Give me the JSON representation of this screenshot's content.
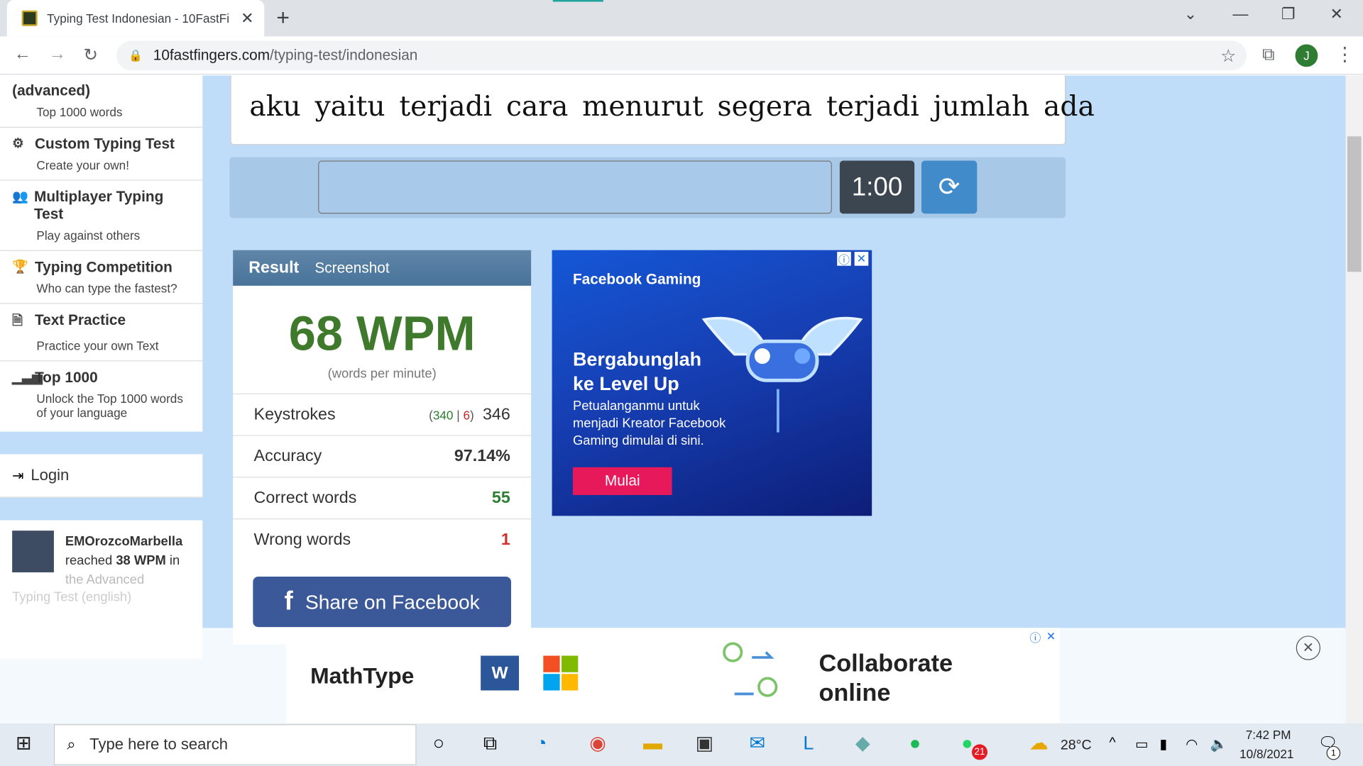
{
  "browser": {
    "tab_title": "Typing Test Indonesian - 10FastFi",
    "new_tab": "+",
    "url_host": "10fastfingers.com",
    "url_path": "/typing-test/indonesian",
    "avatar_letter": "J"
  },
  "sidebar": {
    "partial_item": {
      "title": "(advanced)",
      "sub": "Top 1000 words"
    },
    "items": [
      {
        "title": "Custom Typing Test",
        "sub": "Create your own!",
        "icon": "gears-icon"
      },
      {
        "title": "Multiplayer Typing Test",
        "sub": "Play against others",
        "icon": "users-icon"
      },
      {
        "title": "Typing Competition",
        "sub": "Who can type the fastest?",
        "icon": "trophy-icon"
      },
      {
        "title": "Text Practice",
        "sub": "Practice your own Text",
        "icon": "document-icon"
      },
      {
        "title": "Top 1000",
        "sub": "Unlock the Top 1000 words of your language",
        "icon": "signal-icon"
      }
    ],
    "login": "Login",
    "feed": {
      "user": "EMOrozcoMarbella",
      "text_a": "reached",
      "wpm": "38 WPM",
      "text_b": "in",
      "text_c": "the Advanced",
      "text_d": "Typing Test (english)"
    }
  },
  "test": {
    "words_line": "aku yaitu terjadi cara menurut segera terjadi jumlah ada",
    "timer": "1:00"
  },
  "result": {
    "tab_result": "Result",
    "tab_screenshot": "Screenshot",
    "wpm": "68 WPM",
    "wpm_sub": "(words per minute)",
    "rows": {
      "keystrokes_label": "Keystrokes",
      "keystrokes_ok": "340",
      "keystrokes_bad": "6",
      "keystrokes_total": "346",
      "accuracy_label": "Accuracy",
      "accuracy": "97.14%",
      "correct_label": "Correct words",
      "correct": "55",
      "wrong_label": "Wrong words",
      "wrong": "1"
    },
    "share": "Share on Facebook"
  },
  "fb_ad": {
    "brand": "Facebook Gaming",
    "headline_1": "Bergabunglah",
    "headline_2": "ke Level Up",
    "body_1": "Petualanganmu untuk",
    "body_2": "menjadi Kreator Facebook",
    "body_3": "Gaming dimulai di sini.",
    "cta": "Mulai"
  },
  "bottom_ad": {
    "brand": "MathType",
    "headline_1": "Collaborate",
    "headline_2": "online"
  },
  "taskbar": {
    "search_placeholder": "Type here to search",
    "temp": "28°C",
    "time": "7:42 PM",
    "date": "10/8/2021",
    "whatsapp_badge": "21",
    "notif_badge": "1"
  }
}
